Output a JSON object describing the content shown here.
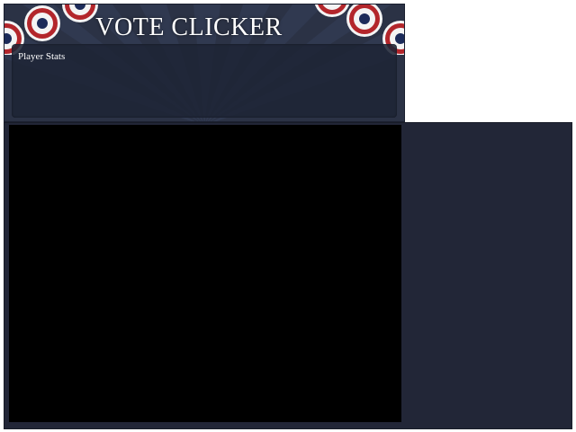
{
  "header": {
    "title": "VOTE CLICKER",
    "stats_label": "Player Stats"
  },
  "decorations": {
    "bunting_icon": "patriotic-bunting-rosette",
    "colors": {
      "red": "#b3262b",
      "white": "#f4f4f4",
      "navy": "#1c2b5a",
      "background": "#2b3245",
      "panel": "#1e2436",
      "lower_panel": "#222637"
    }
  },
  "game_area": {
    "canvas_color": "#000000"
  }
}
